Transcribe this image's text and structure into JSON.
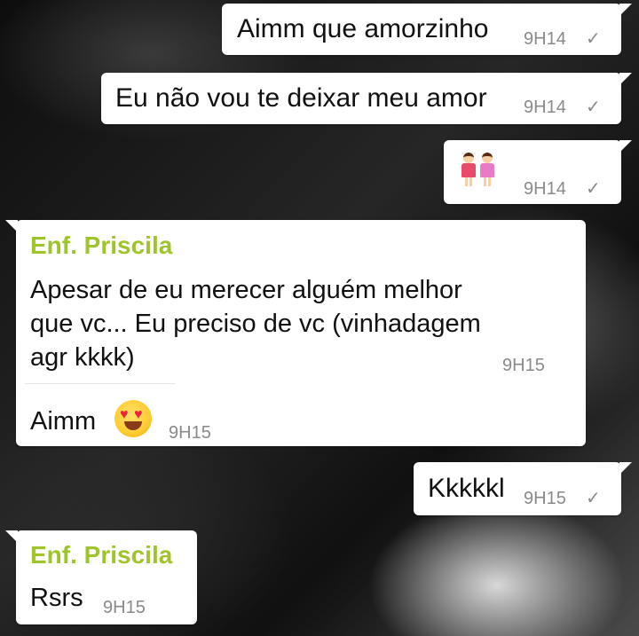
{
  "messages": [
    {
      "text": "Aimm que amorzinho",
      "time": "9H14",
      "status": "✓"
    },
    {
      "text": "Eu não vou te deixar meu amor",
      "time": "9H14",
      "status": "✓"
    },
    {
      "emoji": "two-girls-emoji",
      "time": "9H14",
      "status": "✓"
    },
    {
      "sender": "Enf. Priscila",
      "lines": [
        "Apesar de eu merecer alguém melhor",
        "que vc... Eu preciso de vc (vinhadagem",
        "agr kkkk)"
      ],
      "time": "9H15",
      "reply": "Aimm",
      "reply_emoji": "heart-eyes-emoji",
      "reply_time": "9H15"
    },
    {
      "text": "Kkkkkl",
      "time": "9H15",
      "status": "✓"
    },
    {
      "sender": "Enf. Priscila",
      "text": "Rsrs",
      "time": "9H15"
    }
  ],
  "colors": {
    "sender": "#9fc52a",
    "bubble": "#ffffff",
    "timestamp": "#8a8a8a"
  }
}
